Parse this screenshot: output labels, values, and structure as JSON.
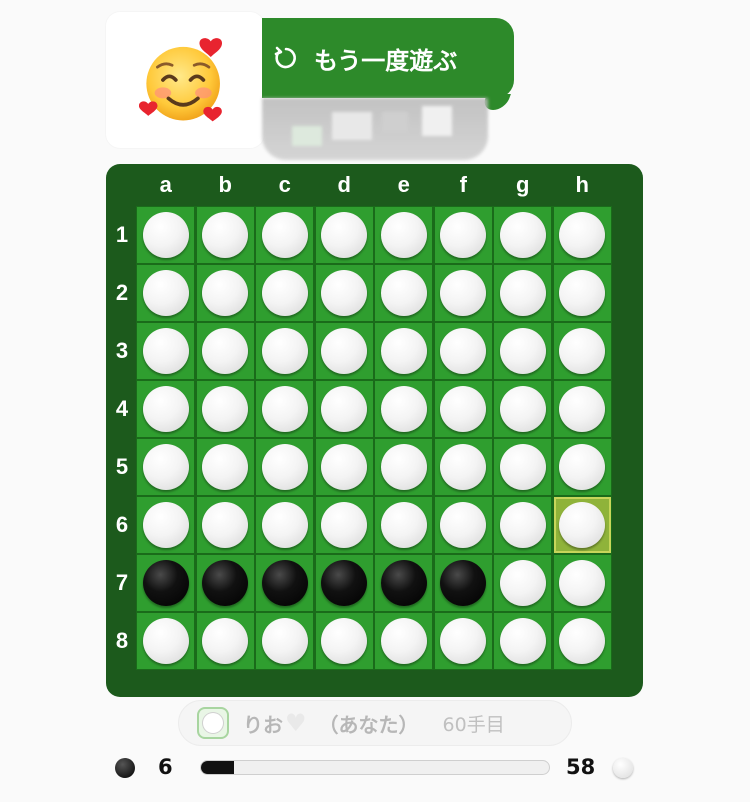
{
  "avatar": {
    "emoji": "smiling-face-with-hearts"
  },
  "replay_button": {
    "label": "もう一度遊ぶ",
    "icon": "replay-icon"
  },
  "board": {
    "columns": [
      "a",
      "b",
      "c",
      "d",
      "e",
      "f",
      "g",
      "h"
    ],
    "rows": [
      "1",
      "2",
      "3",
      "4",
      "5",
      "6",
      "7",
      "8"
    ],
    "cells": [
      [
        "W",
        "W",
        "W",
        "W",
        "W",
        "W",
        "W",
        "W"
      ],
      [
        "W",
        "W",
        "W",
        "W",
        "W",
        "W",
        "W",
        "W"
      ],
      [
        "W",
        "W",
        "W",
        "W",
        "W",
        "W",
        "W",
        "W"
      ],
      [
        "W",
        "W",
        "W",
        "W",
        "W",
        "W",
        "W",
        "W"
      ],
      [
        "W",
        "W",
        "W",
        "W",
        "W",
        "W",
        "W",
        "W"
      ],
      [
        "W",
        "W",
        "W",
        "W",
        "W",
        "W",
        "W",
        "W"
      ],
      [
        "B",
        "B",
        "B",
        "B",
        "B",
        "B",
        "W",
        "W"
      ],
      [
        "W",
        "W",
        "W",
        "W",
        "W",
        "W",
        "W",
        "W"
      ]
    ],
    "last_move": "h6",
    "colors": {
      "frame": "#1c5a1c",
      "cell": "#2f9e2f",
      "highlight": "#8fb33a"
    }
  },
  "player": {
    "name": "りお",
    "you_label": "（あなた）",
    "move_count": "60手目"
  },
  "score": {
    "black": "6",
    "white": "58",
    "black_share": 0.094
  }
}
